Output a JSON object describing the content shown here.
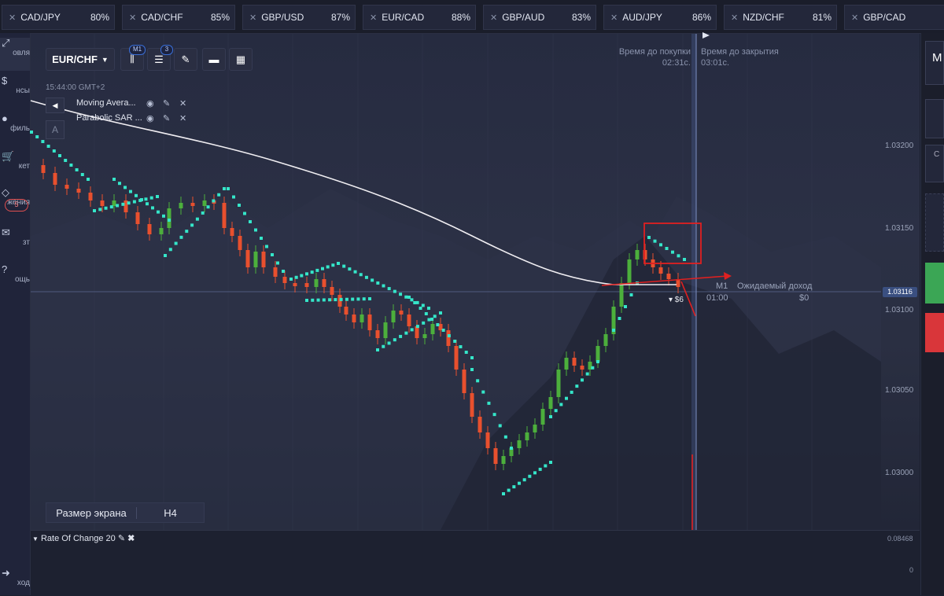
{
  "tabs": [
    {
      "pair": "CAD/JPY",
      "pct": "80%"
    },
    {
      "pair": "CAD/CHF",
      "pct": "85%"
    },
    {
      "pair": "GBP/USD",
      "pct": "87%"
    },
    {
      "pair": "EUR/CAD",
      "pct": "88%"
    },
    {
      "pair": "GBP/AUD",
      "pct": "83%"
    },
    {
      "pair": "AUD/JPY",
      "pct": "86%"
    },
    {
      "pair": "NZD/CHF",
      "pct": "81%"
    },
    {
      "pair": "GBP/CAD",
      "pct": ""
    }
  ],
  "nav": [
    {
      "icon": "trade-icon",
      "label": "овля"
    },
    {
      "icon": "finance-icon",
      "label": "нсы"
    },
    {
      "icon": "profile-icon",
      "label": "филь"
    },
    {
      "icon": "market-icon",
      "label": "кет"
    },
    {
      "icon": "achievements-icon",
      "label": "жения"
    },
    {
      "icon": "chat-icon",
      "label": "зт"
    },
    {
      "icon": "help-icon",
      "label": "ощь"
    },
    {
      "icon": "exit-icon",
      "label": "ход"
    }
  ],
  "nav_badge": "5",
  "toolbar": {
    "pair": "EUR/CHF",
    "timeframe_badge": "M1",
    "indicators_badge": "3"
  },
  "time_display": "15:44:00 GMT+2",
  "indicators": [
    {
      "name": "Moving Avera..."
    },
    {
      "name": "Parabolic SAR ..."
    }
  ],
  "a_button": "A",
  "purchase": {
    "label": "Время до покупки",
    "value": "02:31с."
  },
  "closing": {
    "label": "Время до закрытия",
    "value": "03:01с."
  },
  "price_labels": [
    "1.03200",
    "1.03150",
    "1.03100",
    "1.03050",
    "1.03000"
  ],
  "current_price": "1.03116",
  "expected": {
    "timeframe": "M1",
    "time": "01:00",
    "label": "Ожидаемый доход",
    "sum": "$0"
  },
  "trade_amount": "▾ $6",
  "screen_size": {
    "label": "Размер экрана",
    "value": "H4"
  },
  "roc": {
    "label": "Rate Of Change",
    "period": "20",
    "max": "0.08468",
    "zero": "0"
  },
  "right_panel": {
    "label_m": "M",
    "label_c": "C"
  },
  "colors": {
    "bull": "#4caf3c",
    "bear": "#e8502e",
    "sar": "#35e6c9",
    "ma": "#f0eef2",
    "roc": "#2d5be0",
    "annotation": "#e02020"
  }
}
